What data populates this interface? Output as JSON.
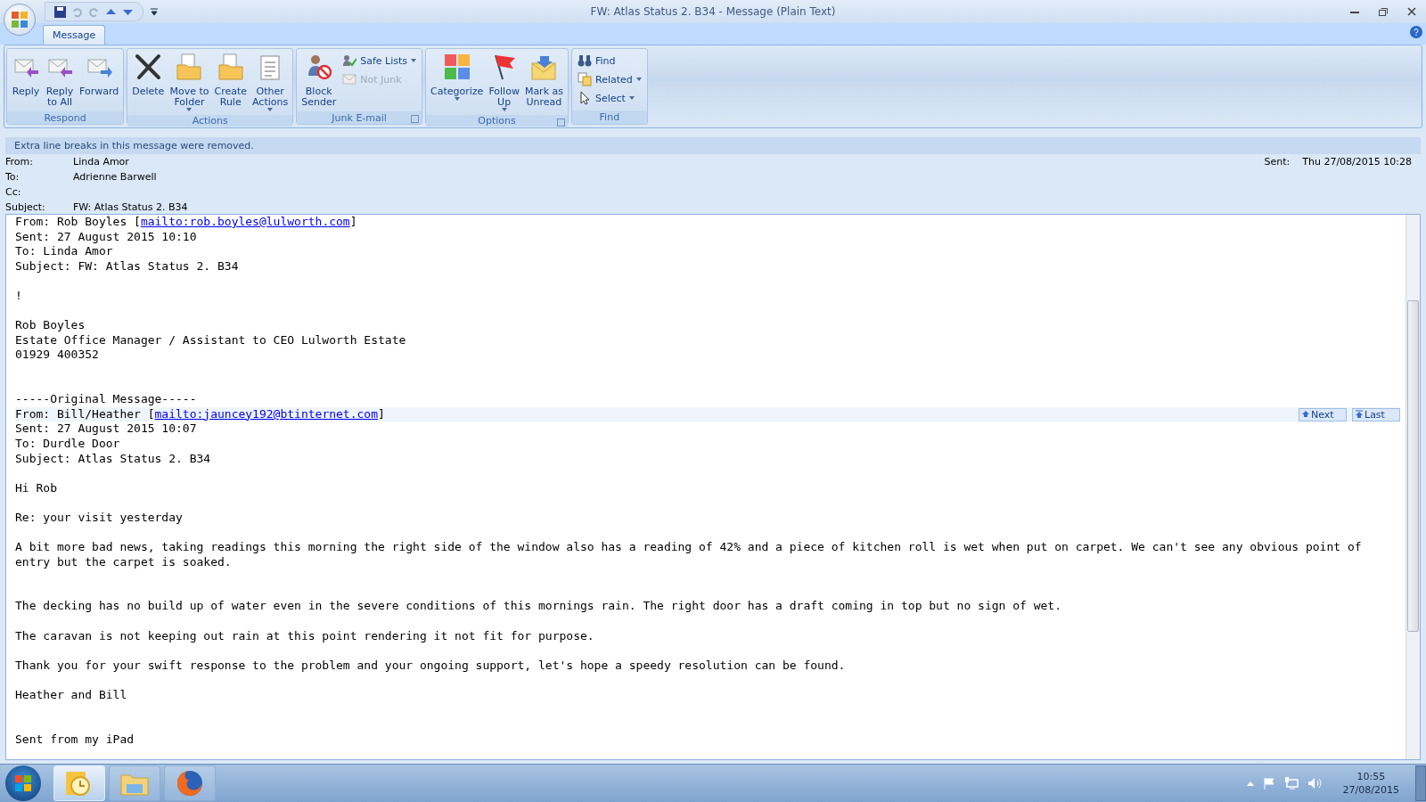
{
  "window": {
    "title": "FW: Atlas Status 2. B34 - Message (Plain Text)"
  },
  "tabs": [
    {
      "label": "Message",
      "selected": true
    }
  ],
  "ribbon_groups": [
    {
      "label": "Respond",
      "launcher": false,
      "items": [
        {
          "kind": "large",
          "label": "Reply",
          "dropdown": false
        },
        {
          "kind": "large",
          "label": "Reply\nto All",
          "dropdown": false
        },
        {
          "kind": "large",
          "label": "Forward",
          "dropdown": false
        }
      ]
    },
    {
      "label": "Actions",
      "launcher": false,
      "items": [
        {
          "kind": "large",
          "label": "Delete",
          "dropdown": false
        },
        {
          "kind": "large",
          "label": "Move to\nFolder",
          "dropdown": true
        },
        {
          "kind": "large",
          "label": "Create\nRule",
          "dropdown": false
        },
        {
          "kind": "large",
          "label": "Other\nActions",
          "dropdown": true
        }
      ]
    },
    {
      "label": "Junk E-mail",
      "launcher": true,
      "items": [
        {
          "kind": "large",
          "label": "Block\nSender",
          "dropdown": false
        },
        {
          "kind": "stack",
          "items": [
            {
              "label": "Safe Lists",
              "dropdown": true,
              "disabled": false
            },
            {
              "label": "Not Junk",
              "dropdown": false,
              "disabled": true
            }
          ]
        }
      ]
    },
    {
      "label": "Options",
      "launcher": true,
      "items": [
        {
          "kind": "large",
          "label": "Categorize",
          "dropdown": true
        },
        {
          "kind": "large",
          "label": "Follow\nUp",
          "dropdown": true
        },
        {
          "kind": "large",
          "label": "Mark as\nUnread",
          "dropdown": false
        }
      ]
    },
    {
      "label": "Find",
      "launcher": false,
      "items": [
        {
          "kind": "stack",
          "items": [
            {
              "label": "Find",
              "dropdown": false,
              "disabled": false
            },
            {
              "label": "Related",
              "dropdown": true,
              "disabled": false
            },
            {
              "label": "Select",
              "dropdown": true,
              "disabled": false
            }
          ]
        }
      ]
    }
  ],
  "info_bar": "Extra line breaks in this message were removed.",
  "header": {
    "fields": [
      {
        "label": "From:",
        "value": "Linda Amor"
      },
      {
        "label": "To:",
        "value": "Adrienne Barwell"
      },
      {
        "label": "Cc:"
      },
      {
        "label": "Subject:",
        "value": "FW: Atlas Status 2. B34"
      }
    ],
    "sent_label": "Sent:",
    "sent_value": "Thu 27/08/2015 10:28"
  },
  "body": [
    {
      "kind": "link",
      "prefix": "From: Rob Boyles [",
      "link": "mailto:rob.boyles@lulworth.com",
      "suffix": "]"
    },
    {
      "kind": "text",
      "text": "Sent: 27 August 2015 10:10"
    },
    {
      "kind": "text",
      "text": "To: Linda Amor"
    },
    {
      "kind": "text",
      "text": "Subject: FW: Atlas Status 2. B34"
    },
    {
      "kind": "blank"
    },
    {
      "kind": "text",
      "text": "!"
    },
    {
      "kind": "blank"
    },
    {
      "kind": "text",
      "text": "Rob Boyles"
    },
    {
      "kind": "text",
      "text": "Estate Office Manager / Assistant to CEO Lulworth Estate"
    },
    {
      "kind": "text",
      "text": "01929 400352"
    },
    {
      "kind": "blank"
    },
    {
      "kind": "blank"
    },
    {
      "kind": "text",
      "text": "-----Original Message-----"
    },
    {
      "kind": "link",
      "prefix": "From: Bill/Heather [",
      "link": "mailto:jauncey192@btinternet.com",
      "suffix": "]",
      "nav": [
        "Next",
        "Last"
      ]
    },
    {
      "kind": "text",
      "text": "Sent: 27 August 2015 10:07"
    },
    {
      "kind": "text",
      "text": "To: Durdle Door"
    },
    {
      "kind": "text",
      "text": "Subject: Atlas Status 2. B34"
    },
    {
      "kind": "blank"
    },
    {
      "kind": "text",
      "text": "Hi Rob"
    },
    {
      "kind": "blank"
    },
    {
      "kind": "text",
      "text": "Re: your visit yesterday"
    },
    {
      "kind": "blank"
    },
    {
      "kind": "text",
      "text": "A bit more bad news, taking readings this morning the right side of the window also has a reading of 42% and a piece of kitchen roll is wet when put on carpet. We can't see any obvious point of entry but the carpet is soaked."
    },
    {
      "kind": "blank"
    },
    {
      "kind": "blank"
    },
    {
      "kind": "text",
      "text": "The decking has no build up of water even in the severe conditions of this mornings rain. The right door has a draft coming in top but no sign of wet."
    },
    {
      "kind": "blank"
    },
    {
      "kind": "text",
      "text": "The caravan is not keeping out rain at this point rendering it not fit for purpose."
    },
    {
      "kind": "blank"
    },
    {
      "kind": "text",
      "text": "Thank you for your swift response to the problem and your ongoing support, let's hope a speedy resolution can be found."
    },
    {
      "kind": "blank"
    },
    {
      "kind": "text",
      "text": "Heather and Bill"
    },
    {
      "kind": "blank"
    },
    {
      "kind": "blank"
    },
    {
      "kind": "text",
      "text": "Sent from my iPad"
    }
  ],
  "taskbar": {
    "apps": [
      {
        "selected": true
      },
      {
        "selected": false
      },
      {
        "selected": false
      }
    ],
    "time": "10:55",
    "date": "27/08/2015"
  }
}
